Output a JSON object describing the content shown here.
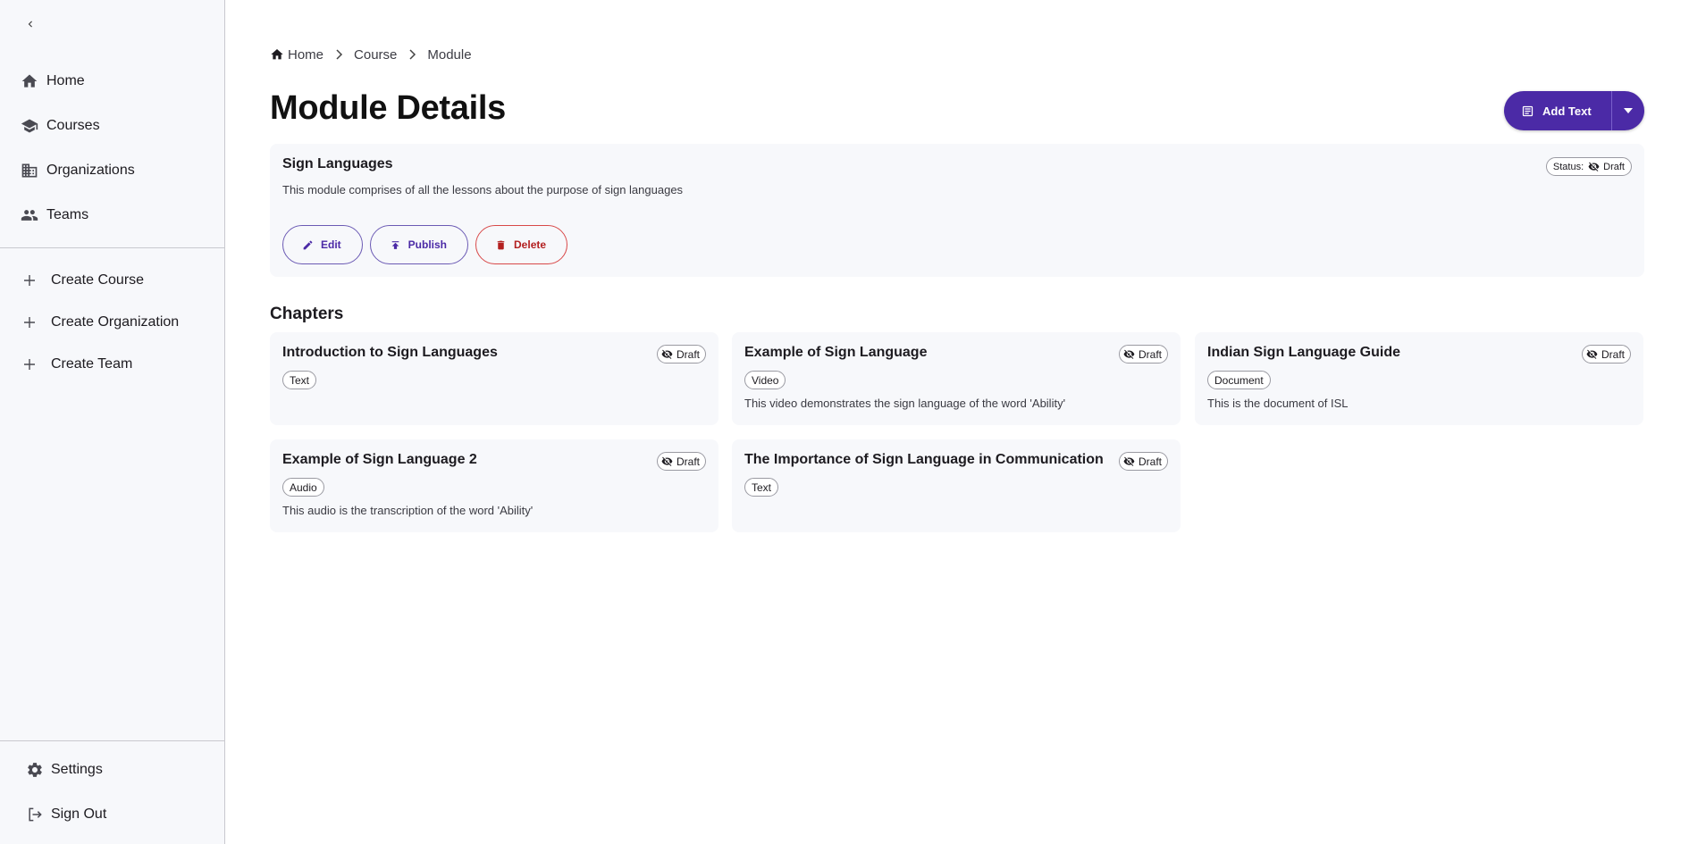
{
  "sidebar": {
    "nav": [
      {
        "label": "Home",
        "icon": "home-icon"
      },
      {
        "label": "Courses",
        "icon": "school-icon"
      },
      {
        "label": "Organizations",
        "icon": "building-icon"
      },
      {
        "label": "Teams",
        "icon": "people-icon"
      }
    ],
    "create": [
      {
        "label": "Create Course",
        "icon": "plus-icon"
      },
      {
        "label": "Create Organization",
        "icon": "plus-icon"
      },
      {
        "label": "Create Team",
        "icon": "plus-icon"
      }
    ],
    "bottom": [
      {
        "label": "Settings",
        "icon": "gear-icon"
      },
      {
        "label": "Sign Out",
        "icon": "logout-icon"
      }
    ]
  },
  "breadcrumb": [
    "Home",
    "Course",
    "Module"
  ],
  "page_title": "Module Details",
  "add_button": {
    "label": "Add Text"
  },
  "module": {
    "name": "Sign Languages",
    "description": "This module comprises of all the lessons about the purpose of sign languages",
    "status_label": "Status:",
    "status_value": "Draft",
    "actions": {
      "edit": "Edit",
      "publish": "Publish",
      "delete": "Delete"
    }
  },
  "chapters_title": "Chapters",
  "chapters": [
    {
      "title": "Introduction to Sign Languages",
      "status": "Draft",
      "type": "Text",
      "description": ""
    },
    {
      "title": "Example of Sign Language",
      "status": "Draft",
      "type": "Video",
      "description": "This video demonstrates the sign language of the word 'Ability'"
    },
    {
      "title": "Indian Sign Language Guide",
      "status": "Draft",
      "type": "Document",
      "description": "This is the document of ISL"
    },
    {
      "title": "Example of Sign Language 2",
      "status": "Draft",
      "type": "Audio",
      "description": "This audio is the transcription of the word 'Ability'"
    },
    {
      "title": "The Importance of Sign Language in Communication",
      "status": "Draft",
      "type": "Text",
      "description": ""
    }
  ],
  "colors": {
    "primary": "#4b2aa6",
    "danger": "#b32020",
    "surface": "#f7f8fb"
  }
}
